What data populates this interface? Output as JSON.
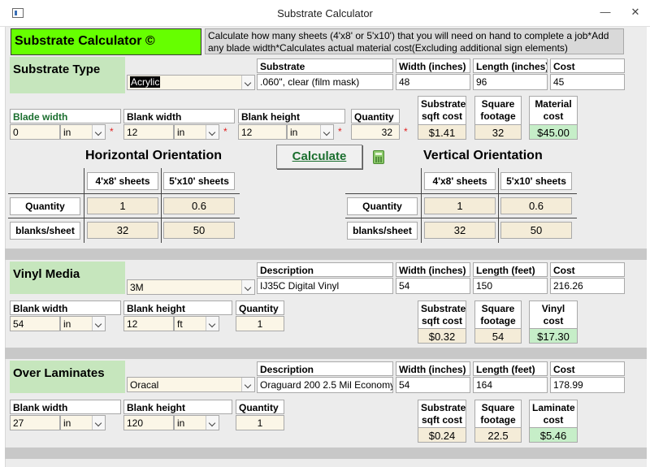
{
  "window": {
    "title": "Substrate Calculator",
    "minimize": "—",
    "close": "✕"
  },
  "header": {
    "title": "Substrate Calculator ©",
    "description": "Calculate how many sheets (4'x8' or 5'x10') that you will need on hand to complete a job*Add any blade width*Calculates actual material cost(Excluding additional sign elements)"
  },
  "substrate": {
    "section_title": "Substrate Type",
    "type_value": "Acrylic",
    "substrate_label": "Substrate",
    "substrate_value": ".060\", clear (film mask)",
    "width_label": "Width (inches)",
    "width_value": "48",
    "length_label": "Length (inches)",
    "length_value": "96",
    "cost_label": "Cost",
    "cost_value": "45",
    "blade_label": "Blade width",
    "blade_value": "0",
    "blade_unit": "in",
    "blank_width_label": "Blank width",
    "blank_width_value": "12",
    "blank_width_unit": "in",
    "blank_height_label": "Blank height",
    "blank_height_value": "12",
    "blank_height_unit": "in",
    "quantity_label": "Quantity",
    "quantity_value": "32",
    "sqft_cost_label": "Substrate sqft cost",
    "sqft_cost_value": "$1.41",
    "sq_footage_label": "Square footage",
    "sq_footage_value": "32",
    "material_cost_label": "Material cost",
    "material_cost_value": "$45.00",
    "required_mark": "*"
  },
  "horizontal": {
    "title": "Horizontal Orientation",
    "col1": "4'x8' sheets",
    "col2": "5'x10' sheets",
    "row1": "Quantity",
    "row2": "blanks/sheet",
    "q1": "1",
    "q2": "0.6",
    "b1": "32",
    "b2": "50"
  },
  "vertical": {
    "title": "Vertical Orientation",
    "col1": "4'x8' sheets",
    "col2": "5'x10' sheets",
    "row1": "Quantity",
    "row2": "blanks/sheet",
    "q1": "1",
    "q2": "0.6",
    "b1": "32",
    "b2": "50"
  },
  "calculate_label": "Calculate",
  "vinyl": {
    "section_title": "Vinyl Media",
    "brand_value": "3M",
    "desc_label": "Description",
    "desc_value": "IJ35C Digital Vinyl",
    "width_label": "Width (inches)",
    "width_value": "54",
    "length_label": "Length (feet)",
    "length_value": "150",
    "cost_label": "Cost",
    "cost_value": "216.26",
    "blank_width_label": "Blank width",
    "blank_width_value": "54",
    "blank_width_unit": "in",
    "blank_height_label": "Blank height",
    "blank_height_value": "12",
    "blank_height_unit": "ft",
    "quantity_label": "Quantity",
    "quantity_value": "1",
    "sqft_cost_label": "Substrate sqft cost",
    "sqft_cost_value": "$0.32",
    "sq_footage_label": "Square footage",
    "sq_footage_value": "54",
    "cost_out_label": "Vinyl cost",
    "cost_out_value": "$17.30"
  },
  "laminate": {
    "section_title": "Over Laminates",
    "brand_value": "Oracal",
    "desc_label": "Description",
    "desc_value": "Oraguard 200 2.5 Mil Economy",
    "width_label": "Width (inches)",
    "width_value": "54",
    "length_label": "Length (feet)",
    "length_value": "164",
    "cost_label": "Cost",
    "cost_value": "178.99",
    "blank_width_label": "Blank width",
    "blank_width_value": "27",
    "blank_width_unit": "in",
    "blank_height_label": "Blank height",
    "blank_height_value": "120",
    "blank_height_unit": "in",
    "quantity_label": "Quantity",
    "quantity_value": "1",
    "sqft_cost_label": "Substrate sqft cost",
    "sqft_cost_value": "$0.24",
    "sq_footage_label": "Square footage",
    "sq_footage_value": "22.5",
    "cost_out_label": "Laminate cost",
    "cost_out_value": "$5.46"
  }
}
